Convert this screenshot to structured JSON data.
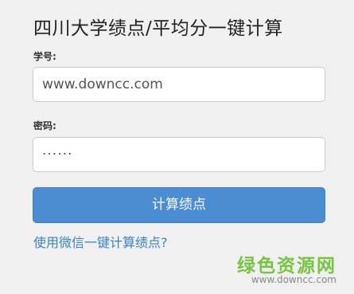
{
  "page": {
    "title": "四川大学绩点/平均分一键计算"
  },
  "form": {
    "student_id_label": "学号:",
    "student_id_value": "www.downcc.com",
    "password_label": "密码:",
    "password_value": "······",
    "submit_label": "计算绩点"
  },
  "wechat_link": {
    "text": "使用微信一键计算绩点?"
  },
  "watermark": {
    "name": "绿色资源网",
    "url": "www.downcc.com"
  },
  "colors": {
    "background": "#f0f0f0",
    "button": "#4a8dd3",
    "link": "#3a82c4",
    "watermark": "#6cbf2f"
  }
}
